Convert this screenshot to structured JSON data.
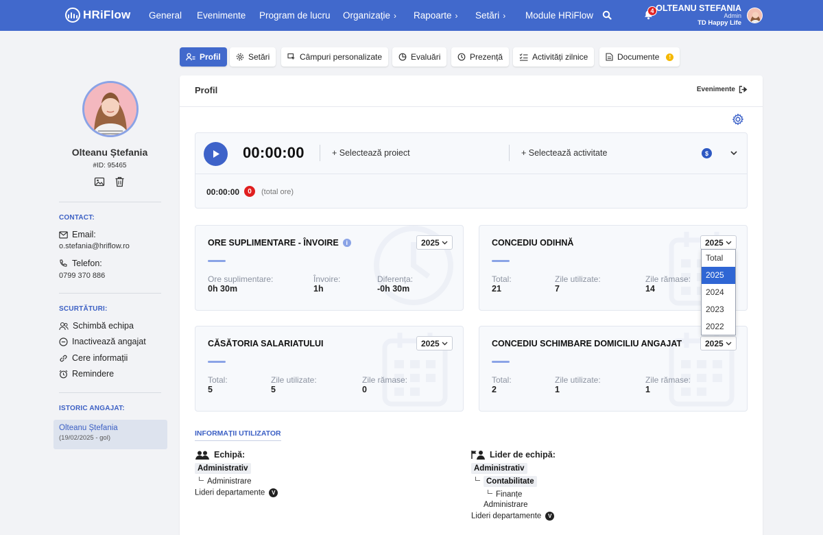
{
  "app": {
    "logo_text": "HRiFlow"
  },
  "nav": {
    "items": [
      {
        "label": "General",
        "has_submenu": false
      },
      {
        "label": "Evenimente",
        "has_submenu": false
      },
      {
        "label": "Program de lucru",
        "has_submenu": false
      },
      {
        "label": "Organizație",
        "has_submenu": true
      },
      {
        "label": "Rapoarte",
        "has_submenu": true
      },
      {
        "label": "Setări",
        "has_submenu": true
      },
      {
        "label": "Module HRiFlow",
        "has_submenu": false
      }
    ],
    "notification_count": "4",
    "user": {
      "name": "OLTEANU STEFANIA",
      "role": "Admin",
      "company": "TD Happy Life"
    }
  },
  "tabs": [
    {
      "label": "Profil",
      "icon": "user-list-icon",
      "active": true
    },
    {
      "label": "Setări",
      "icon": "gear-icon"
    },
    {
      "label": "Câmpuri personalizate",
      "icon": "cursor-edit-icon"
    },
    {
      "label": "Evaluări",
      "icon": "pie-icon"
    },
    {
      "label": "Prezență",
      "icon": "clock-icon"
    },
    {
      "label": "Activități zilnice",
      "icon": "checklist-icon"
    },
    {
      "label": "Documente",
      "icon": "document-icon",
      "warning": "!"
    }
  ],
  "sidebar": {
    "name": "Olteanu Ștefania",
    "id_text": "#ID: 95465",
    "contact_title": "CONTACT:",
    "email_label": "Email:",
    "email_value": "o.stefania@hriflow.ro",
    "phone_label": "Telefon:",
    "phone_value": "0799 370 886",
    "shortcuts_title": "SCURTĂTURI:",
    "shortcuts": [
      {
        "label": "Schimbă echipa",
        "icon": "users-icon"
      },
      {
        "label": "Inactivează angajat",
        "icon": "minus-circle-icon"
      },
      {
        "label": "Cere informații",
        "icon": "link-icon"
      },
      {
        "label": "Remindere",
        "icon": "alarm-clock-icon"
      }
    ],
    "history_title": "ISTORIC ANGAJAT:",
    "history": [
      {
        "name": "Olteanu Ștefania",
        "date": "(19/02/2025 - gol)"
      }
    ]
  },
  "main": {
    "title": "Profil",
    "events_link": "Evenimente",
    "timer": {
      "value": "00:00:00",
      "select_project": "+ Selectează proiect",
      "select_activity": "+ Selectează activitate",
      "total_value": "00:00:00",
      "total_badge": "0",
      "total_note": "(total ore)"
    },
    "widgets": {
      "overtime": {
        "title": "ORE SUPLIMENTARE - ÎNVOIRE",
        "year": "2025",
        "labels": [
          "Ore suplimentare:",
          "Învoire:",
          "Diferența:"
        ],
        "values": [
          "0h 30m",
          "1h",
          "-0h 30m"
        ]
      },
      "vacation": {
        "title": "CONCEDIU ODIHNĂ",
        "year": "2025",
        "labels": [
          "Total:",
          "Zile utilizate:",
          "Zile rămase:"
        ],
        "values": [
          "21",
          "7",
          "14"
        ]
      },
      "marriage": {
        "title": "CĂSĂTORIA SALARIATULUI",
        "year": "2025",
        "labels": [
          "Total:",
          "Zile utilizate:",
          "Zile rămase:"
        ],
        "values": [
          "5",
          "5",
          "0"
        ]
      },
      "relocation": {
        "title": "CONCEDIU SCHIMBARE DOMICILIU ANGAJAT",
        "year": "2025",
        "labels": [
          "Total:",
          "Zile utilizate:",
          "Zile rămase:"
        ],
        "values": [
          "2",
          "1",
          "1"
        ]
      }
    },
    "year_dropdown": {
      "options": [
        "Total",
        "2025",
        "2024",
        "2023",
        "2022"
      ],
      "selected": "2025"
    },
    "user_info": {
      "title": "INFORMAȚII UTILIZATOR",
      "team": {
        "label": "Echipă:",
        "root": "Administrativ",
        "child": "Administrare",
        "extra": "Lideri departamente",
        "extra_badge": "V"
      },
      "leader": {
        "label": "Lider de echipă:",
        "root": "Administrativ",
        "child": "Contabilitate",
        "grandchild": "Finanțe",
        "sibling": "Administrare",
        "extra": "Lideri departamente",
        "extra_badge": "V"
      }
    }
  },
  "colors": {
    "primary": "#4169cc",
    "accent": "#8aa3e6",
    "danger": "#e01f1f",
    "warning": "#f5b800"
  }
}
